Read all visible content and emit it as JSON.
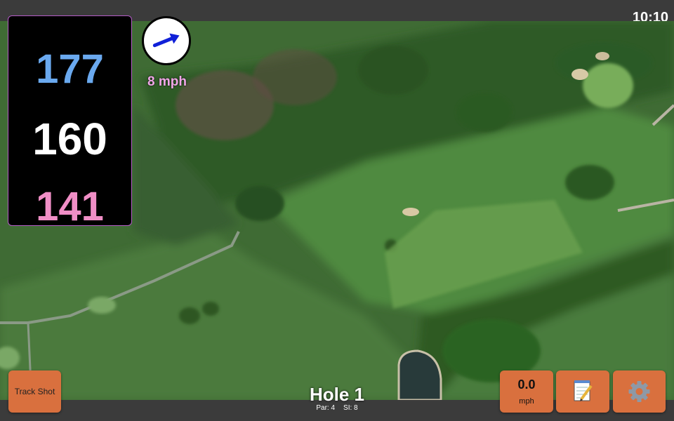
{
  "status_bar": {
    "time": "10:10"
  },
  "distances": {
    "back": "177",
    "middle": "160",
    "front": "141"
  },
  "wind": {
    "speed": "8 mph",
    "direction_icon": "arrow-icon"
  },
  "buttons": {
    "track_shot": "Track Shot",
    "speed_value": "0.0",
    "speed_unit": "mph",
    "notes_icon": "notepad-icon",
    "settings_icon": "gear-icon"
  },
  "hole": {
    "title": "Hole 1",
    "par": "Par: 4",
    "stroke_index": "SI: 8"
  },
  "colors": {
    "back": "#6aa9ef",
    "middle": "#ffffff",
    "front": "#f08ec6",
    "button": "#d9703e",
    "wind_text": "#f1a7e8"
  }
}
